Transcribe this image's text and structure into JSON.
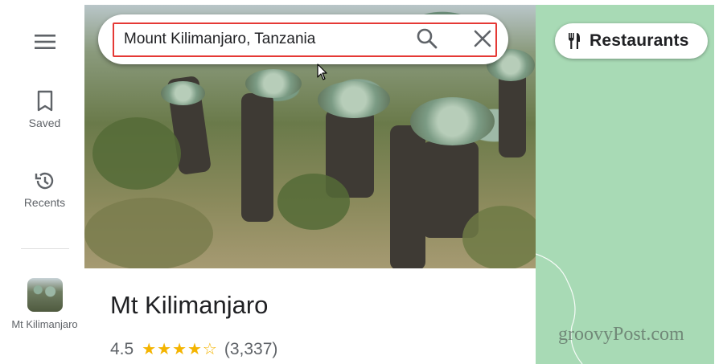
{
  "rail": {
    "saved_label": "Saved",
    "recents_label": "Recents",
    "recent_place_label": "Mt Kilimanjaro"
  },
  "search": {
    "value": "Mount Kilimanjaro, Tanzania"
  },
  "chip": {
    "label": "Restaurants"
  },
  "place": {
    "title": "Mt Kilimanjaro",
    "rating": "4.5",
    "stars": "★★★★☆",
    "reviews": "(3,337)"
  },
  "watermark": "groovyPost.com",
  "colors": {
    "highlight": "#e53935",
    "map_green": "#a8dab5",
    "star": "#f4b400"
  }
}
